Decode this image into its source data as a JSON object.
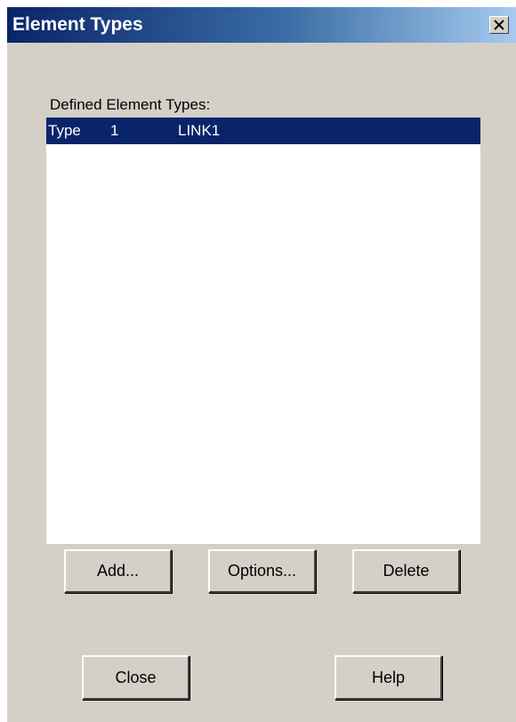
{
  "window": {
    "title": "Element Types"
  },
  "list": {
    "label": "Defined Element Types:",
    "rows": [
      {
        "type_label": "Type",
        "number": "1",
        "name": "LINK1",
        "selected": true
      }
    ]
  },
  "buttons": {
    "add": "Add...",
    "options": "Options...",
    "delete": "Delete",
    "close": "Close",
    "help": "Help"
  },
  "colors": {
    "dialog_bg": "#d4d0c8",
    "titlebar_start": "#0a246a",
    "titlebar_end": "#a6caf0",
    "selection_bg": "#0a246a",
    "selection_text": "#ffffff"
  },
  "icons": {
    "close": "close-icon"
  }
}
